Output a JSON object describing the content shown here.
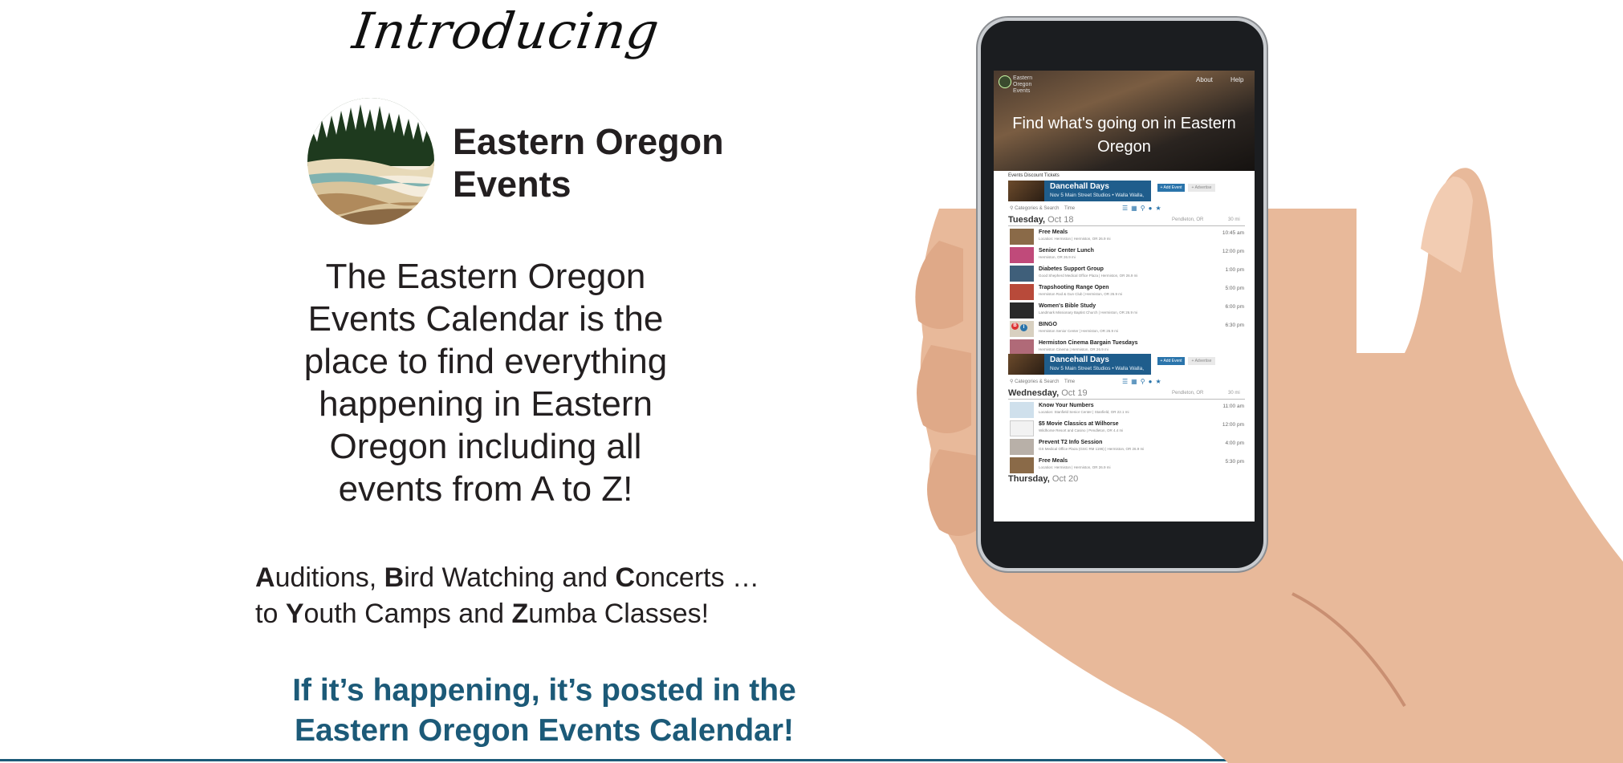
{
  "intro": "Introducing",
  "brand": {
    "line1": "Eastern Oregon",
    "line2": "Events"
  },
  "description": [
    "The Eastern Oregon",
    "Events Calendar is the",
    "place to find everything",
    "happening in Eastern",
    "Oregon including all",
    "events from A to Z!"
  ],
  "alphabet": {
    "line1": [
      {
        "b": "A",
        "t": "uditions, "
      },
      {
        "b": "B",
        "t": "ird Watching and "
      },
      {
        "b": "C",
        "t": "oncerts …"
      }
    ],
    "line2": [
      {
        "b": "",
        "t": "to "
      },
      {
        "b": "Y",
        "t": "outh Camps and "
      },
      {
        "b": "Z",
        "t": "umba Classes!"
      }
    ]
  },
  "tagline": {
    "line1": "If it’s happening, it’s posted in the",
    "line2": "Eastern Oregon Events Calendar!"
  },
  "colors": {
    "accent": "#1c5a78",
    "banner": "#1f5d8c",
    "text": "#231f20"
  },
  "phone": {
    "site_name": "Eastern Oregon Events",
    "nav": [
      "About",
      "Help"
    ],
    "hero_title": [
      "Find what's going on in Eastern",
      "Oregon"
    ],
    "tabs": "Events  Discount Tickets",
    "banner": {
      "title": "Dancehall Days",
      "subtitle": "Nov 5   Main Street Studios   •  Walla Walla,"
    },
    "buttons": [
      "+ Add Event",
      "+ Advertise"
    ],
    "toolbar": {
      "search": "Categories & Search",
      "time": "Time"
    },
    "toolbar_icons": [
      "list-icon",
      "grid-icon",
      "map-pin-icon",
      "person-icon",
      "star-icon"
    ],
    "days": [
      {
        "label": "Tuesday,",
        "date": "Oct 18",
        "location": "Pendleton, OR",
        "distance": "30 mi",
        "events": [
          {
            "title": "Free Meals",
            "sub": "Location: Hermiston | Hermiston, OR   26.9 mi",
            "time": "10:45 am"
          },
          {
            "title": "Senior Center Lunch",
            "sub": "Hermiston, OR   26.9 mi",
            "time": "12:00 pm"
          },
          {
            "title": "Diabetes Support Group",
            "sub": "Good Shepherd Medical Office Plaza | Hermiston, OR   26.9 mi",
            "time": "1:00 pm"
          },
          {
            "title": "Trapshooting Range Open",
            "sub": "Hermiston Rod & Gun Club | Hermiston, OR   26.9 mi",
            "time": "5:00 pm"
          },
          {
            "title": "Women's Bible Study",
            "sub": "Landmark Missionary Baptist Church | Hermiston, OR   26.9 mi",
            "time": "6:00 pm"
          },
          {
            "title": "BINGO",
            "sub": "Hermiston Senior Center | Hermiston, OR   26.9 mi",
            "time": "6:30 pm"
          },
          {
            "title": "Hermiston Cinema Bargain Tuesdays",
            "sub": "Hermiston Cinema | Hermiston, OR   26.9 mi",
            "time": ""
          }
        ]
      },
      {
        "label": "Wednesday,",
        "date": "Oct 19",
        "location": "Pendleton, OR",
        "distance": "30 mi",
        "events": [
          {
            "title": "Know Your Numbers",
            "sub": "Location: Stanfield Senior Center | Stanfield, OR   22.1 mi",
            "time": "11:00 am"
          },
          {
            "title": "$5 Movie Classics at Wilhorse",
            "sub": "Wildhorse Resort and Casino | Pendleton, OR   4.4 mi",
            "time": "12:00 pm"
          },
          {
            "title": "Prevent T2 Info Session",
            "sub": "GS Medical Office Plaza (GSC RM 1196) | Hermiston, OR   26.9 mi",
            "time": "4:00 pm"
          },
          {
            "title": "Free Meals",
            "sub": "Location: Hermiston | Hermiston, OR   26.9 mi",
            "time": "5:30 pm"
          }
        ]
      },
      {
        "label": "Thursday,",
        "date": "Oct 20",
        "events": []
      }
    ]
  }
}
